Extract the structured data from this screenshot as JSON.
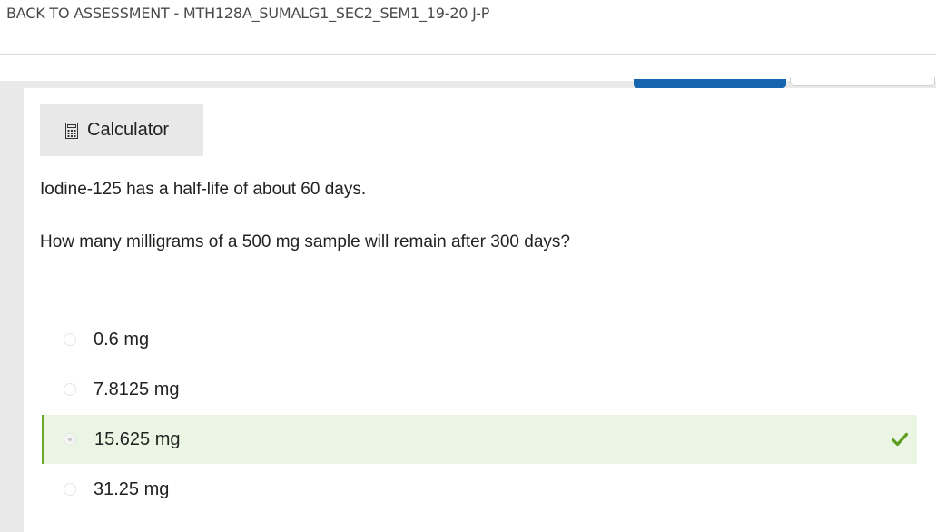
{
  "header": {
    "back_link": "BACK TO ASSESSMENT - MTH128A_SUMALG1_SEC2_SEM1_19-20 J-P"
  },
  "toolbar": {
    "calculator_label": "Calculator",
    "calculator_icon": "calculator-icon"
  },
  "question": {
    "line1": "Iodine-125 has a half-life of about 60 days.",
    "line2": "How many milligrams of a 500 mg sample will remain after 300 days?"
  },
  "options": [
    {
      "label": "0.6 mg",
      "selected": false,
      "correct": false
    },
    {
      "label": "7.8125 mg",
      "selected": false,
      "correct": false
    },
    {
      "label": "15.625 mg",
      "selected": true,
      "correct": true
    },
    {
      "label": "31.25 mg",
      "selected": false,
      "correct": false
    }
  ],
  "colors": {
    "accent_blue": "#1565b0",
    "correct_bg": "#eaf5e3",
    "correct_green": "#6aa827"
  }
}
